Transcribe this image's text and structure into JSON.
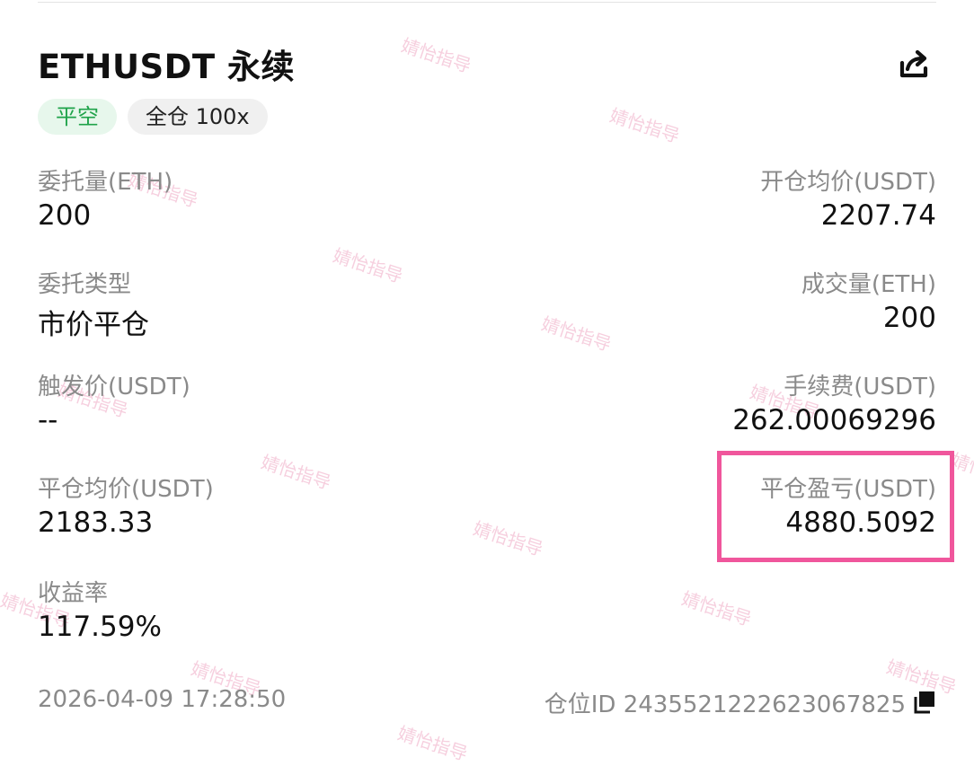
{
  "header": {
    "title": "ETHUSDT 永续",
    "share_icon": "share-icon"
  },
  "badges": {
    "direction": "平空",
    "margin_mode": "全仓 100x"
  },
  "fields": {
    "order_qty": {
      "label": "委托量(ETH)",
      "value": "200"
    },
    "open_avg_price": {
      "label": "开仓均价(USDT)",
      "value": "2207.74"
    },
    "order_type": {
      "label": "委托类型",
      "value": "市价平仓"
    },
    "filled_qty": {
      "label": "成交量(ETH)",
      "value": "200"
    },
    "trigger_price": {
      "label": "触发价(USDT)",
      "value": "--"
    },
    "fee": {
      "label": "手续费(USDT)",
      "value": "262.00069296"
    },
    "close_avg_price": {
      "label": "平仓均价(USDT)",
      "value": "2183.33"
    },
    "close_pnl": {
      "label": "平仓盈亏(USDT)",
      "value": "4880.5092"
    },
    "roi": {
      "label": "收益率",
      "value": "117.59%"
    }
  },
  "footer": {
    "timestamp": "2026-04-09 17:28:50",
    "position_id": "仓位ID 2435521222623067825",
    "copy_icon": "copy-icon"
  },
  "watermark": {
    "text": "婧怡指导"
  },
  "colors": {
    "accent_green": "#1fa34a",
    "badge_green_bg": "#e7f7ec",
    "highlight_pink": "#f0569c",
    "label_gray": "#8a8a8a"
  }
}
